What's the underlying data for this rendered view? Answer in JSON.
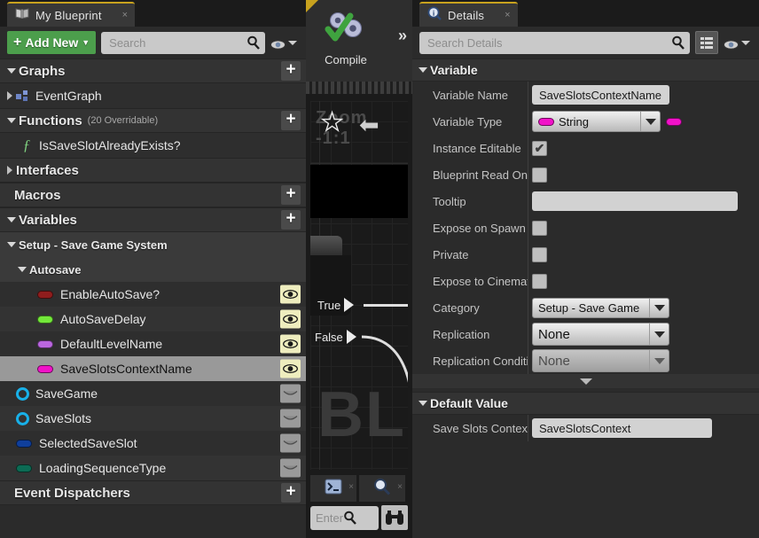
{
  "myblueprint": {
    "tab": {
      "title": "My Blueprint",
      "icon": "book-icon",
      "close": "×"
    },
    "toolbar": {
      "add_new_label": "Add New",
      "add_new_plus": "+",
      "search_placeholder": "Search",
      "search_value": "",
      "search_icon": "magnifier-icon",
      "eye_icon": "eye-icon"
    },
    "sections": {
      "graphs": {
        "label": "Graphs",
        "add": "+"
      },
      "functions": {
        "label": "Functions",
        "sub": "(20 Overridable)",
        "add": "+"
      },
      "interfaces": {
        "label": "Interfaces"
      },
      "macros": {
        "label": "Macros",
        "add": "+"
      },
      "variables": {
        "label": "Variables",
        "add": "+"
      },
      "event_dispatchers": {
        "label": "Event Dispatchers",
        "add": "+"
      }
    },
    "graph_items": [
      {
        "label": "EventGraph",
        "icon": "graph-icon"
      }
    ],
    "function_items": [
      {
        "label": "IsSaveSlotAlreadyExists?",
        "icon": "function-icon"
      }
    ],
    "variable_categories": [
      {
        "label": "Setup - Save Game System"
      },
      {
        "label": "Autosave"
      }
    ],
    "variables_in_category": [
      {
        "label": "EnableAutoSave?",
        "pin_color": "#8f1d1d",
        "eye": "eye-visible-icon",
        "eye_state": "on",
        "selected": false
      },
      {
        "label": "AutoSaveDelay",
        "pin_color": "#73e83a",
        "eye": "eye-visible-icon",
        "eye_state": "on",
        "selected": false
      },
      {
        "label": "DefaultLevelName",
        "pin_color": "#bb66e0",
        "eye": "eye-visible-icon",
        "eye_state": "on",
        "selected": false
      },
      {
        "label": "SaveSlotsContextName",
        "pin_color": "#f112c8",
        "eye": "eye-visible-icon",
        "eye_state": "on",
        "selected": true
      }
    ],
    "variables_root": [
      {
        "label": "SaveGame",
        "pin_style": "ring",
        "pin_color": "#18b0e8",
        "eye_state": "off"
      },
      {
        "label": "SaveSlots",
        "pin_style": "ring",
        "pin_color": "#18b0e8",
        "eye_state": "off"
      },
      {
        "label": "SelectedSaveSlot",
        "pin_style": "bar",
        "pin_color": "#0f3f9c",
        "eye_state": "off"
      },
      {
        "label": "LoadingSequenceType",
        "pin_style": "bar",
        "pin_color": "#0c6b54",
        "eye_state": "off"
      }
    ]
  },
  "graph": {
    "compile": {
      "label": "Compile",
      "icon": "compile-gears-check-icon"
    },
    "chevron": "»",
    "zoom_label": "Zoom -1:1",
    "star_icon": "★",
    "back_icon": "⬅",
    "watermark": "BL",
    "node": {
      "pins": [
        {
          "label": "True"
        },
        {
          "label": "False"
        }
      ]
    },
    "bottom_tabs": [
      {
        "icon": "compiler-results-icon",
        "close": "×"
      },
      {
        "icon": "find-results-icon",
        "close": "×"
      }
    ],
    "bottom_search": {
      "placeholder": "Enter",
      "value": "",
      "search_icon": "magnifier-icon",
      "binoculars_icon": "binoculars-icon"
    }
  },
  "details": {
    "tab": {
      "title": "Details",
      "icon": "info-magnifier-icon",
      "close": "×"
    },
    "toolbar": {
      "search_placeholder": "Search Details",
      "search_value": "",
      "search_icon": "magnifier-icon",
      "grid_icon": "grid-view-icon",
      "eye_icon": "eye-icon"
    },
    "sections": [
      {
        "label": "Variable"
      },
      {
        "label": "Default Value"
      }
    ],
    "variable_rows": [
      {
        "name": "variable-name",
        "label": "Variable Name",
        "type": "text",
        "value": "SaveSlotsContextName"
      },
      {
        "name": "variable-type",
        "label": "Variable Type",
        "type": "combo-pin",
        "value": "String",
        "pin_color": "#f112c8"
      },
      {
        "name": "instance-editable",
        "label": "Instance Editable",
        "type": "checkbox",
        "checked": true,
        "check": "✔"
      },
      {
        "name": "blueprint-read-only",
        "label": "Blueprint Read Onl",
        "type": "checkbox",
        "checked": false
      },
      {
        "name": "tooltip",
        "label": "Tooltip",
        "type": "text-wide",
        "value": ""
      },
      {
        "name": "expose-on-spawn",
        "label": "Expose on Spawn",
        "type": "checkbox",
        "checked": false
      },
      {
        "name": "private",
        "label": "Private",
        "type": "checkbox",
        "checked": false
      },
      {
        "name": "expose-to-cinematics",
        "label": "Expose to Cinemat",
        "type": "checkbox",
        "checked": false
      },
      {
        "name": "category",
        "label": "Category",
        "type": "combo-narrow",
        "value": "Setup - Save Game"
      },
      {
        "name": "replication",
        "label": "Replication",
        "type": "combo",
        "value": "None"
      },
      {
        "name": "replication-condition",
        "label": "Replication Conditi",
        "type": "combo-disabled",
        "value": "None"
      }
    ],
    "default_value_rows": [
      {
        "name": "save-slots-context",
        "label": "Save Slots Context",
        "type": "text",
        "value": "SaveSlotsContext"
      }
    ]
  }
}
